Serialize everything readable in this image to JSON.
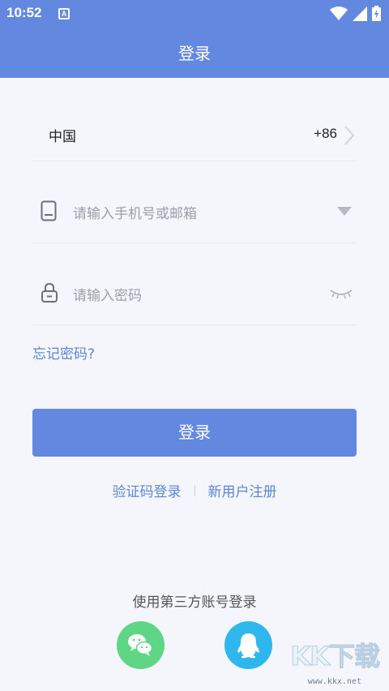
{
  "status_bar": {
    "time": "10:52",
    "notification_badge": "A",
    "icons": [
      "wifi-icon",
      "signal-icon",
      "battery-charging-icon"
    ]
  },
  "header": {
    "title": "登录"
  },
  "country": {
    "name": "中国",
    "code": "+86"
  },
  "phone": {
    "placeholder": "请输入手机号或邮箱"
  },
  "password": {
    "placeholder": "请输入密码"
  },
  "forgot_password": "忘记密码?",
  "login_button": "登录",
  "alt_links": {
    "sms_login": "验证码登录",
    "register": "新用户注册"
  },
  "third_party": {
    "title": "使用第三方账号登录",
    "providers": [
      "wechat",
      "qq"
    ]
  },
  "watermark": {
    "logo": "KK下载",
    "url": "www.kkx.net"
  },
  "colors": {
    "brand": "#6289df",
    "link": "#5b86d6",
    "wechat": "#5ed686",
    "qq": "#2fb6ec",
    "background": "#f5f6fb"
  }
}
